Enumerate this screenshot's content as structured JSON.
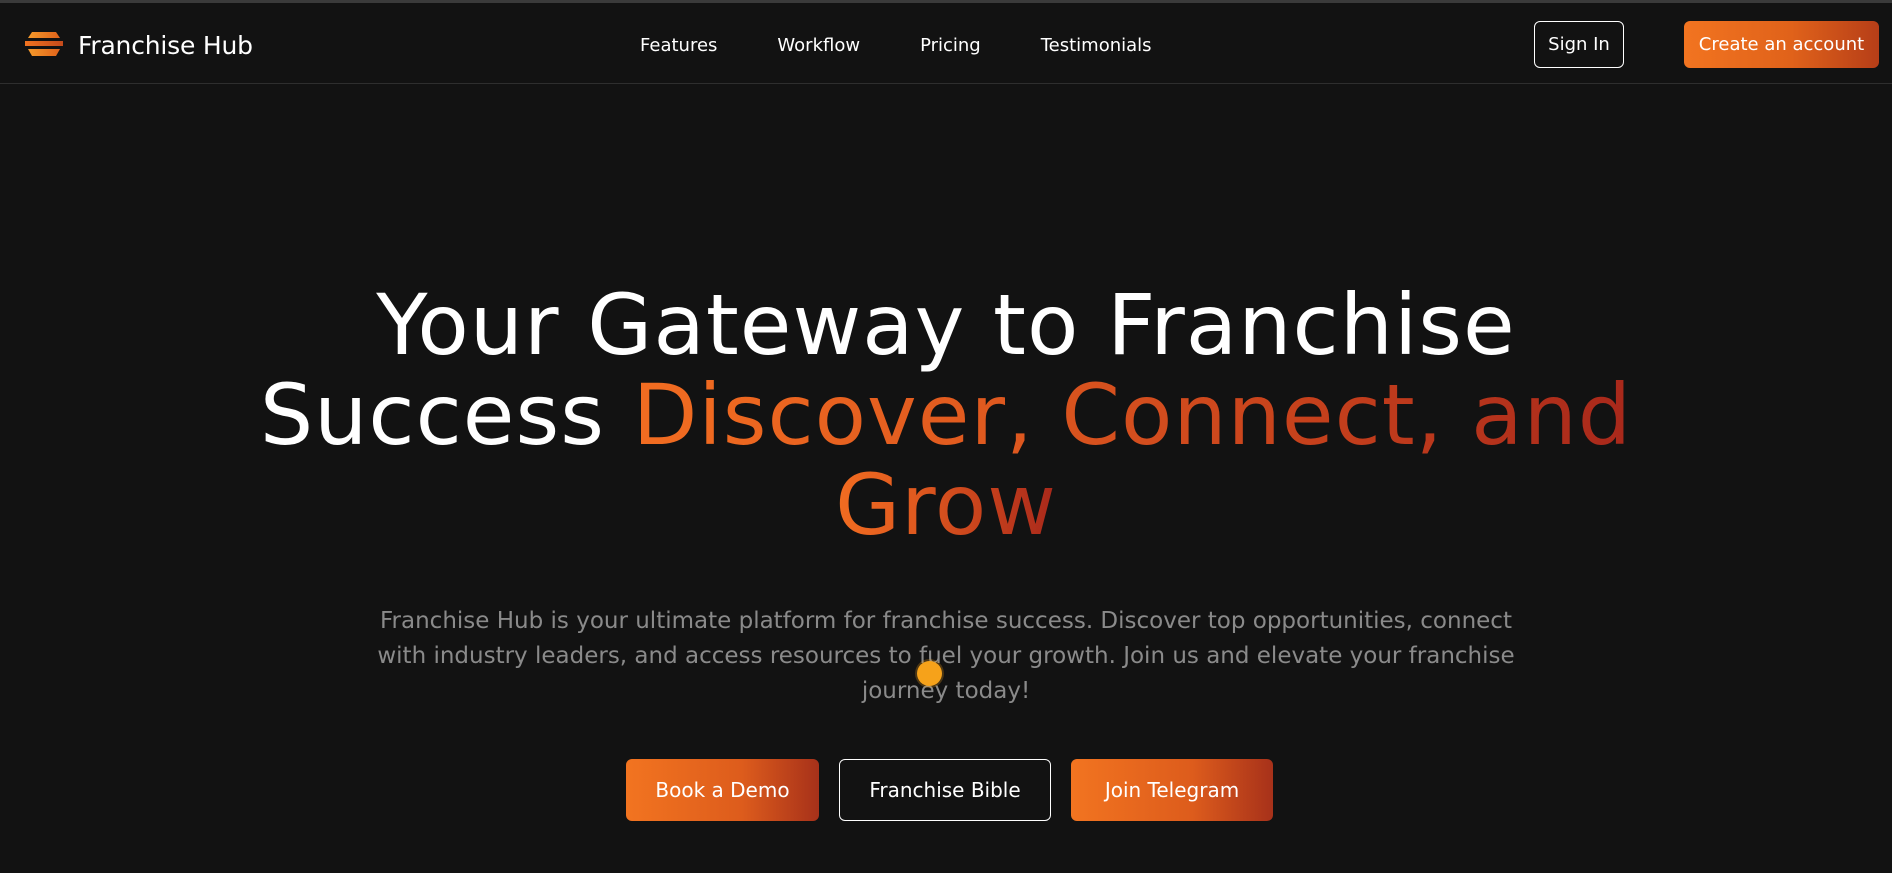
{
  "header": {
    "brand_name": "Franchise Hub",
    "logo_icon": "stacked-layers-logo",
    "nav": [
      {
        "label": "Features"
      },
      {
        "label": "Workflow"
      },
      {
        "label": "Pricing"
      },
      {
        "label": "Testimonials"
      }
    ],
    "sign_in_label": "Sign In",
    "create_account_label": "Create an account"
  },
  "hero": {
    "title_line1": "Your Gateway to Franchise",
    "title_line2_plain": "Success ",
    "title_line2_accent": "Discover, Connect, and",
    "title_line3_accent": "Grow",
    "subtitle": "Franchise Hub is your ultimate platform for franchise success. Discover top opportunities, connect with industry leaders, and access resources to fuel your growth. Join us and elevate your franchise journey today!",
    "buttons": {
      "book_demo": "Book a Demo",
      "franchise_bible": "Franchise Bible",
      "join_telegram": "Join Telegram"
    }
  },
  "colors": {
    "background": "#121212",
    "accent_start": "#f27420",
    "accent_end": "#a8281b",
    "subtitle_gray": "#8a8a8a",
    "cursor_dot": "#f6a21a"
  }
}
